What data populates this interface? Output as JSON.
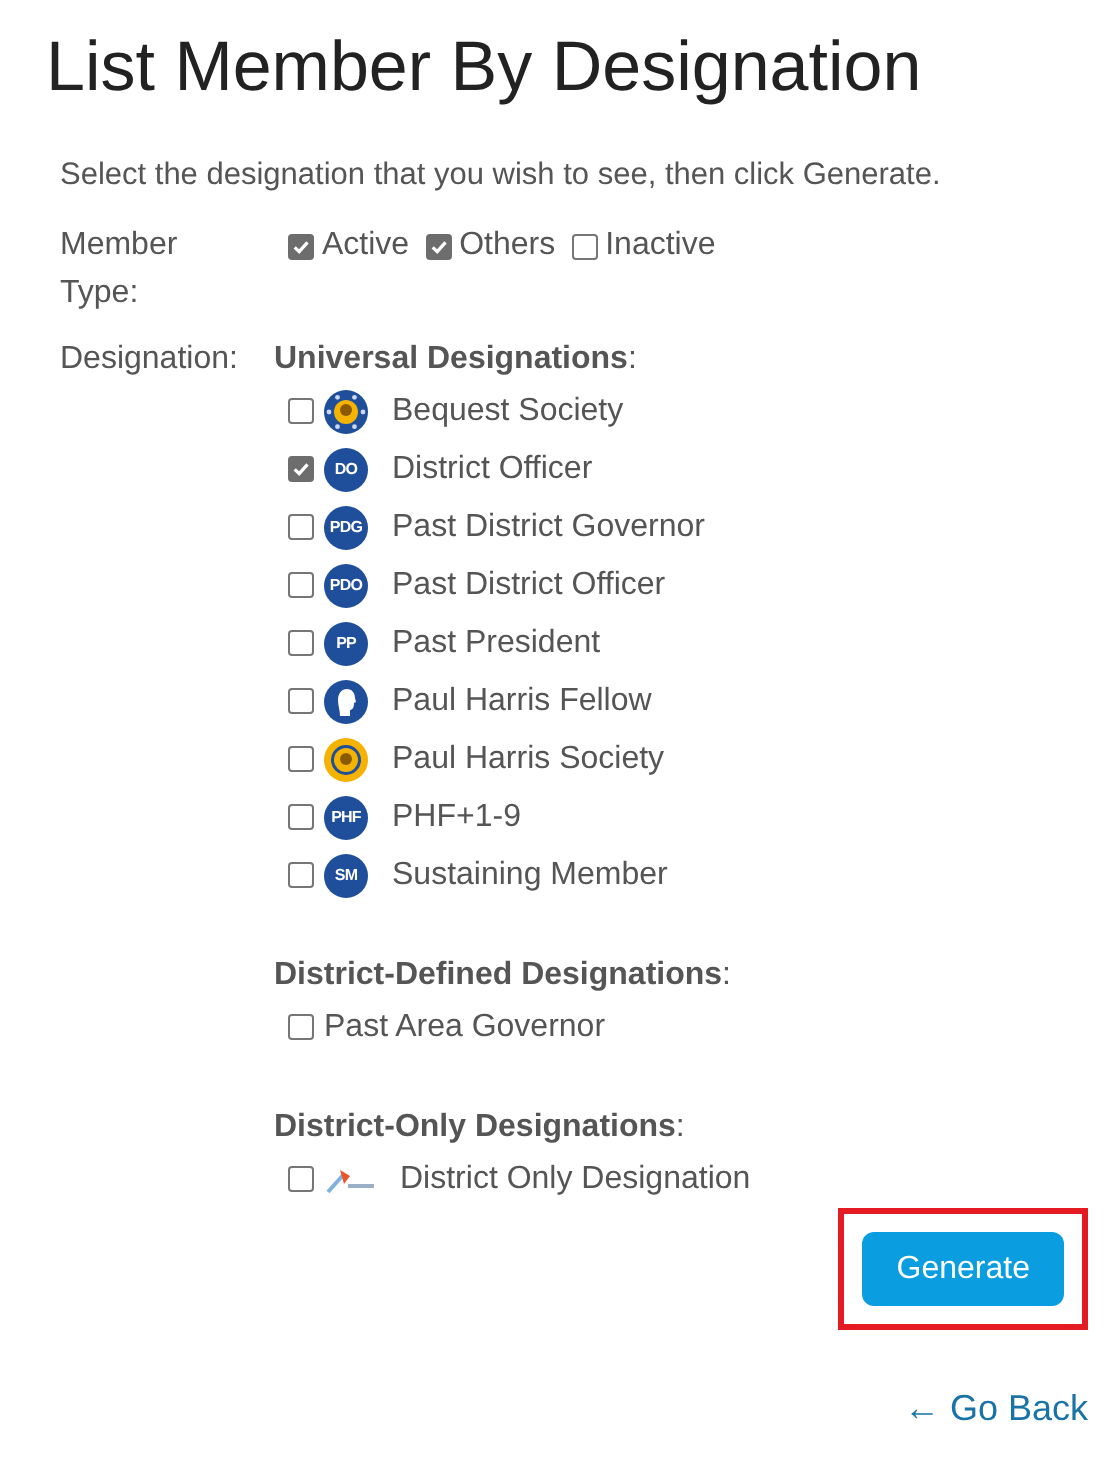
{
  "title": "List Member By Designation",
  "instructions": "Select the designation that you wish to see, then click Generate.",
  "member_type": {
    "label": "Member Type:",
    "options": [
      {
        "label": "Active",
        "checked": true
      },
      {
        "label": "Others",
        "checked": true
      },
      {
        "label": "Inactive",
        "checked": false
      }
    ]
  },
  "designation": {
    "label": "Designation:",
    "groups": [
      {
        "heading": "**Universal Designations**:",
        "items": [
          {
            "label": "Bequest Society",
            "checked": false,
            "kind": "medallion"
          },
          {
            "label": "District Officer",
            "checked": true,
            "kind": "badge",
            "badge": "DO"
          },
          {
            "label": "Past District Governor",
            "checked": false,
            "kind": "badge",
            "badge": "PDG"
          },
          {
            "label": "Past District Officer",
            "checked": false,
            "kind": "badge",
            "badge": "PDO"
          },
          {
            "label": "Past President",
            "checked": false,
            "kind": "badge",
            "badge": "PP"
          },
          {
            "label": "Paul Harris Fellow",
            "checked": false,
            "kind": "profile"
          },
          {
            "label": "Paul Harris Society",
            "checked": false,
            "kind": "coin"
          },
          {
            "label": "PHF+1-9",
            "checked": false,
            "kind": "badge",
            "badge": "PHF"
          },
          {
            "label": "Sustaining Member",
            "checked": false,
            "kind": "badge",
            "badge": "SM"
          }
        ]
      },
      {
        "heading": "**District-Defined Designations**:",
        "items": [
          {
            "label": "Past Area Governor",
            "checked": false,
            "kind": "plain"
          }
        ]
      },
      {
        "heading": "**District-Only Designations**:",
        "items": [
          {
            "label": "District Only Designation",
            "checked": false,
            "kind": "logo"
          }
        ]
      }
    ]
  },
  "generate_button": {
    "label": "Generate",
    "highlighted": true
  },
  "back_link": "← Go Back"
}
